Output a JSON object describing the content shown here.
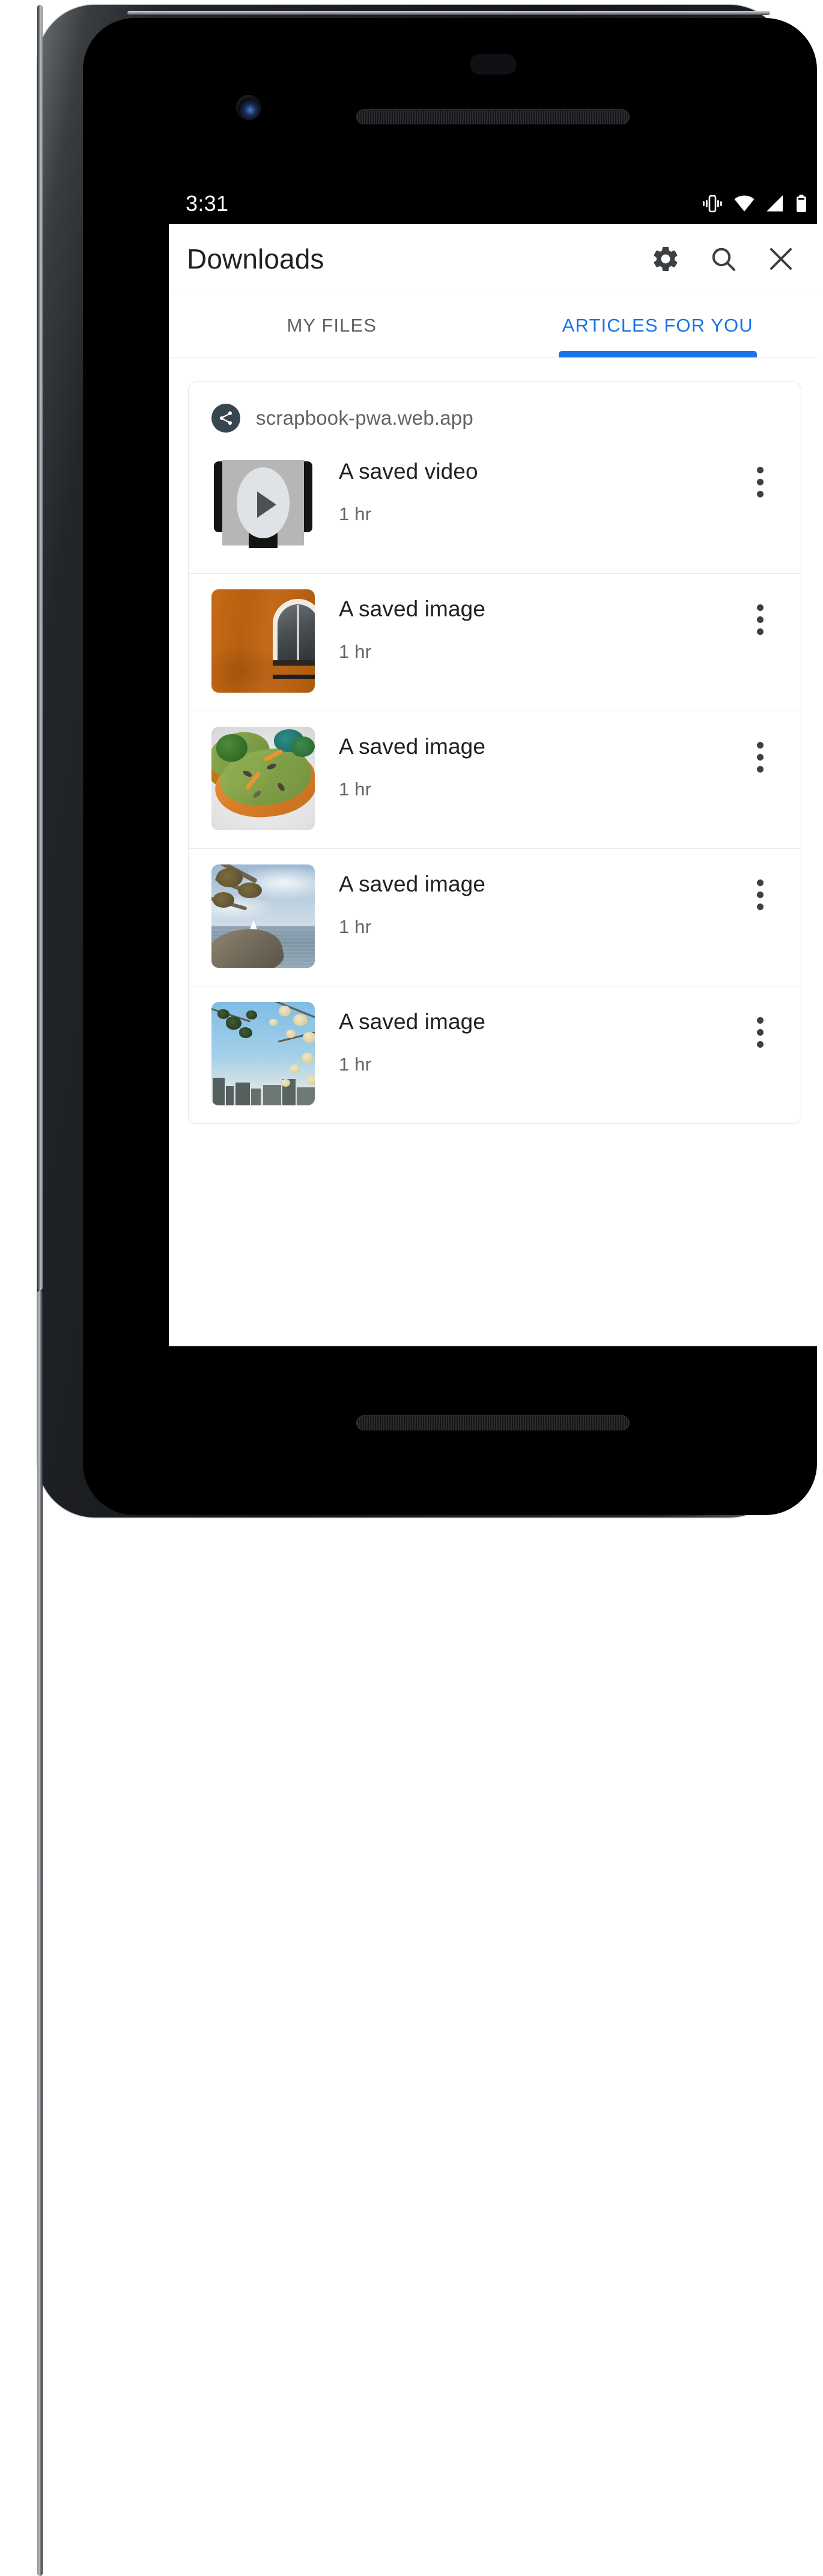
{
  "status_bar": {
    "time": "3:31",
    "icons": [
      "vibrate-icon",
      "wifi-icon",
      "cellular-signal-icon",
      "battery-icon"
    ]
  },
  "toolbar": {
    "title": "Downloads",
    "actions": [
      {
        "name": "settings-button",
        "icon": "gear-icon"
      },
      {
        "name": "search-button",
        "icon": "search-icon"
      },
      {
        "name": "close-button",
        "icon": "close-icon"
      }
    ]
  },
  "tabs": [
    {
      "label": "MY FILES",
      "active": false
    },
    {
      "label": "ARTICLES FOR YOU",
      "active": true
    }
  ],
  "colors": {
    "accent": "#1a73e8",
    "primary_text": "#202124",
    "secondary_text": "#5f6368",
    "divider": "#e8eaec",
    "card_border": "#e4e6e8",
    "status_bar_bg": "#000000",
    "surface": "#ffffff",
    "source_avatar_bg": "#37474f"
  },
  "card": {
    "source": {
      "label": "scrapbook-pwa.web.app",
      "icon": "share-icon"
    },
    "items": [
      {
        "title": "A saved video",
        "subtitle": "1 hr",
        "thumbnail": "video-placeholder-icon",
        "menu": "overflow-menu-icon"
      },
      {
        "title": "A saved image",
        "subtitle": "1 hr",
        "thumbnail": "orange-wall-arched-window-photo",
        "menu": "overflow-menu-icon"
      },
      {
        "title": "A saved image",
        "subtitle": "1 hr",
        "thumbnail": "avocado-toast-photo",
        "menu": "overflow-menu-icon"
      },
      {
        "title": "A saved image",
        "subtitle": "1 hr",
        "thumbnail": "lakeside-sailboat-photo",
        "menu": "overflow-menu-icon"
      },
      {
        "title": "A saved image",
        "subtitle": "1 hr",
        "thumbnail": "city-skyline-blossoms-photo",
        "menu": "overflow-menu-icon"
      }
    ]
  },
  "device": {
    "hardware": [
      "front-camera",
      "proximity-sensor",
      "top-speaker-grille",
      "bottom-speaker-grille",
      "power-button",
      "volume-button"
    ]
  }
}
